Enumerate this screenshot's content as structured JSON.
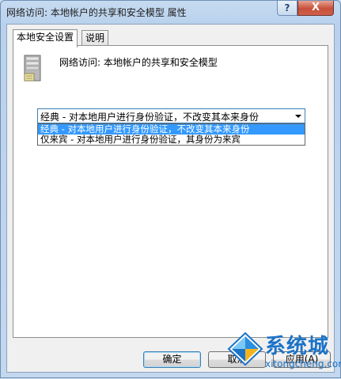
{
  "window": {
    "title": "网络访问: 本地帐户的共享和安全模型 属性",
    "help_label": "?",
    "close_label": "X"
  },
  "tabs": [
    {
      "label": "本地安全设置",
      "active": true
    },
    {
      "label": "说明",
      "active": false
    }
  ],
  "policy": {
    "icon": "server-icon",
    "name": "网络访问: 本地帐户的共享和安全模型"
  },
  "dropdown": {
    "selected": "经典 - 对本地用户进行身份验证，不改变其本来身份",
    "options": [
      "经典 - 对本地用户进行身份验证，不改变其本来身份",
      "仅来宾 - 对本地用户进行身份验证，其身份为来宾"
    ]
  },
  "buttons": {
    "ok": "确定",
    "cancel": "取消",
    "apply": "应用(A)"
  },
  "watermark": {
    "text": "系统城",
    "url": "xitongcheng.com"
  },
  "colors": {
    "selection": "#3399ff",
    "close": "#c7503a",
    "watermark": "#1b73c8"
  }
}
